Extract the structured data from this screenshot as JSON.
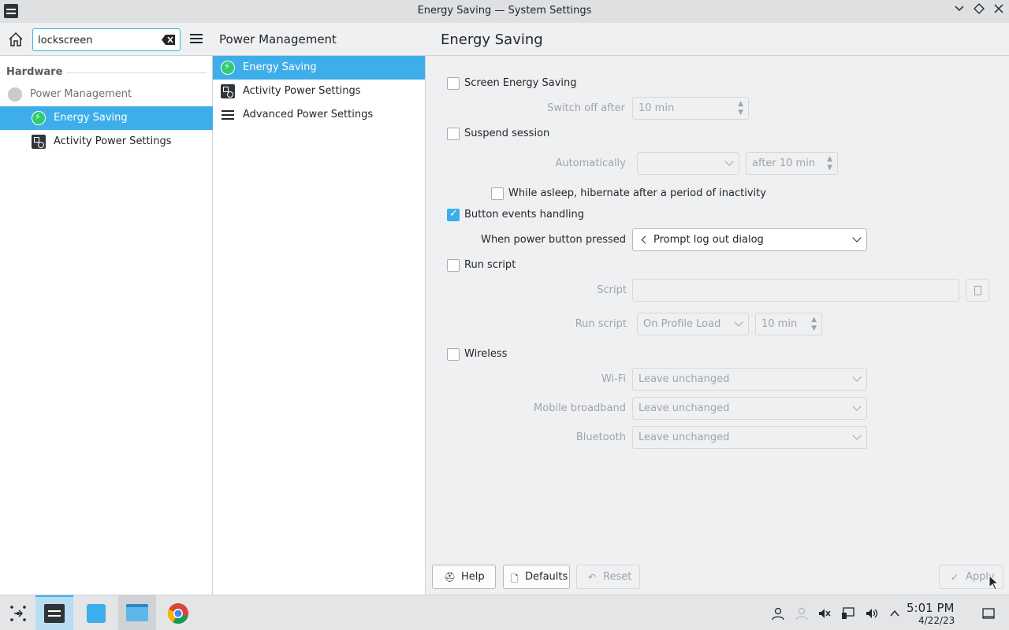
{
  "window": {
    "title": "Energy Saving — System Settings"
  },
  "sidebar": {
    "search_value": "lockscreen",
    "section": "Hardware",
    "items": [
      {
        "label": "Power Management"
      },
      {
        "label": "Energy Saving"
      },
      {
        "label": "Activity Power Settings"
      }
    ]
  },
  "midcol": {
    "header": "Power Management",
    "items": [
      {
        "label": "Energy Saving"
      },
      {
        "label": "Activity Power Settings"
      },
      {
        "label": "Advanced Power Settings"
      }
    ]
  },
  "main": {
    "header": "Energy Saving",
    "screen_energy_saving": {
      "label": "Screen Energy Saving",
      "checked": false
    },
    "switch_off_after": {
      "label": "Switch off after",
      "value": "10 min"
    },
    "suspend_session": {
      "label": "Suspend session",
      "checked": false
    },
    "automatically": {
      "label": "Automatically",
      "value": "",
      "after": "after 10 min"
    },
    "hibernate": {
      "label": "While asleep, hibernate after a period of inactivity",
      "checked": false
    },
    "button_events": {
      "label": "Button events handling",
      "checked": true
    },
    "power_button": {
      "label": "When power button pressed",
      "value": "Prompt log out dialog"
    },
    "run_script": {
      "label": "Run script",
      "checked": false
    },
    "script": {
      "label": "Script",
      "value": ""
    },
    "run_script_when": {
      "label": "Run script",
      "value": "On Profile Load",
      "time": "10 min"
    },
    "wireless": {
      "label": "Wireless",
      "checked": false
    },
    "wifi": {
      "label": "Wi-Fi",
      "value": "Leave unchanged"
    },
    "mobile": {
      "label": "Mobile broadband",
      "value": "Leave unchanged"
    },
    "bluetooth": {
      "label": "Bluetooth",
      "value": "Leave unchanged"
    }
  },
  "buttons": {
    "help": "Help",
    "defaults": "Defaults",
    "reset": "Reset",
    "apply": "Apply"
  },
  "taskbar": {
    "time": "5:01 PM",
    "date": "4/22/23"
  },
  "colors": {
    "accent": "#3daee9",
    "energy_icon": "#2ecc71"
  }
}
